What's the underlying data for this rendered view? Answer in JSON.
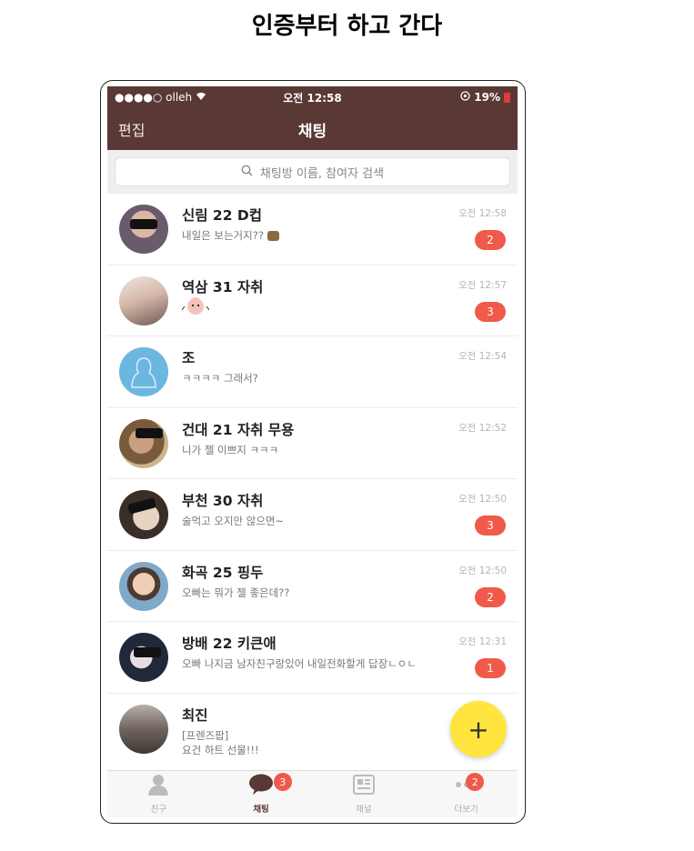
{
  "heading": "인증부터 하고 간다",
  "status": {
    "carrier": "●●●●○ olleh",
    "time": "오전 12:58",
    "battery": "19%"
  },
  "nav": {
    "edit": "편집",
    "title": "채팅"
  },
  "search": {
    "placeholder": "채팅방 이름, 참여자 검색"
  },
  "chats": [
    {
      "name": "신림 22 D컵",
      "preview": "내일은 보는거지??",
      "time": "오전 12:58",
      "badge": "2"
    },
    {
      "name": "역삼 31 자취",
      "preview": "",
      "time": "오전 12:57",
      "badge": "3"
    },
    {
      "name": "조",
      "preview": "ㅋㅋㅋㅋ 그래서?",
      "time": "오전 12:54",
      "badge": ""
    },
    {
      "name": "건대 21 자취 무용",
      "preview": "니가 젤 이쁘지 ㅋㅋㅋ",
      "time": "오전 12:52",
      "badge": ""
    },
    {
      "name": "부천 30 자취",
      "preview": "술먹고 오지만 않으면~",
      "time": "오전 12:50",
      "badge": "3"
    },
    {
      "name": "화곡 25 핑두",
      "preview": "오빠는 뭐가 젤 좋은데??",
      "time": "오전 12:50",
      "badge": "2"
    },
    {
      "name": "방배 22 키큰애",
      "preview": "오빠 나지금 남자친구랑있어 내일전화할게 답장ㄴㅇㄴ",
      "time": "오전 12:31",
      "badge": "1"
    },
    {
      "name": "최진",
      "preview": "[프렌즈팝]",
      "preview2": "요건 하트 선물!!!",
      "time": "",
      "badge": ""
    }
  ],
  "fab": "+",
  "tabs": [
    {
      "label": "친구",
      "badge": ""
    },
    {
      "label": "채팅",
      "badge": "3"
    },
    {
      "label": "채널",
      "badge": ""
    },
    {
      "label": "더보기",
      "badge": "2"
    }
  ],
  "colors": {
    "header": "#5a3836",
    "badge": "#f05a4a",
    "fab": "#ffe53d"
  }
}
